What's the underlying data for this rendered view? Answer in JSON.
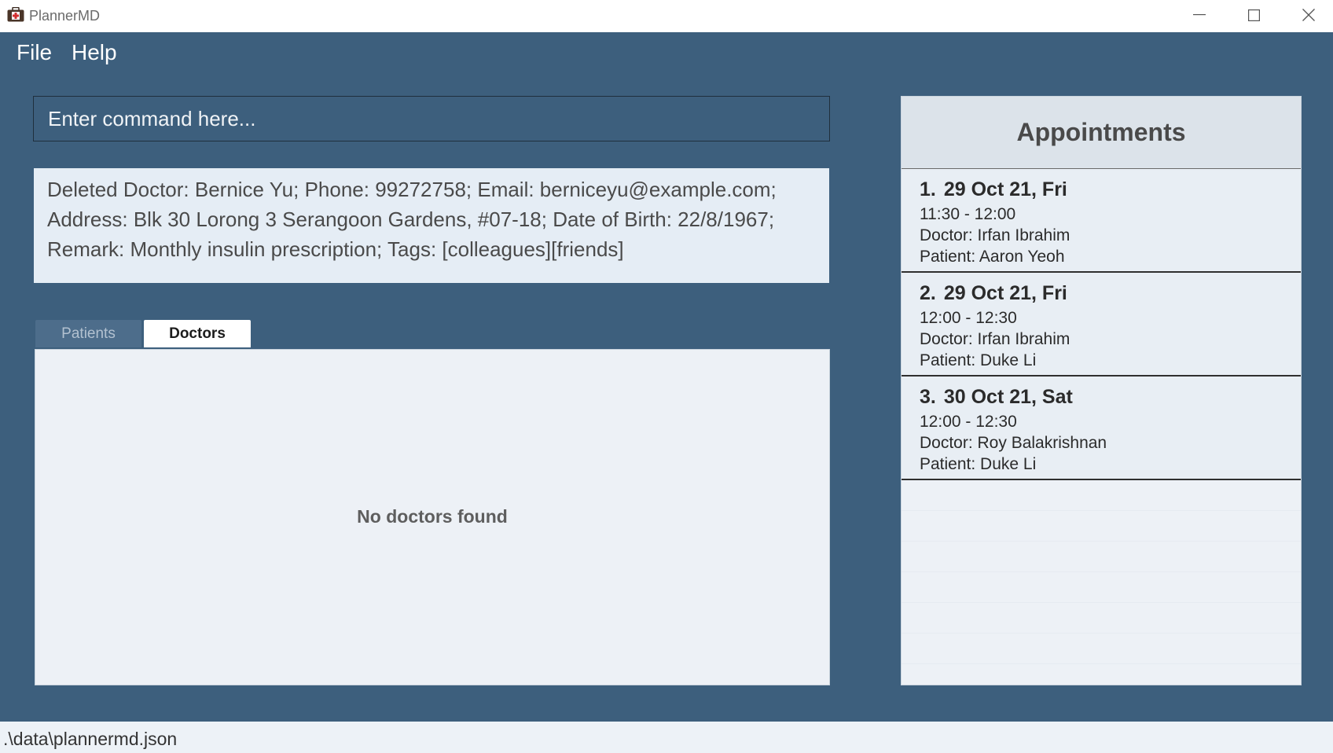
{
  "window": {
    "title": "PlannerMD",
    "icon": "medical-briefcase-icon"
  },
  "menu": {
    "file": "File",
    "help": "Help"
  },
  "command": {
    "placeholder": "Enter command here...",
    "value": ""
  },
  "result": {
    "lines": [
      "Deleted Doctor: Bernice Yu; Phone: 99272758; Email: berniceyu@example.com;",
      "Address: Blk 30 Lorong 3 Serangoon Gardens, #07-18; Date of Birth: 22/8/1967;",
      "Remark: Monthly insulin prescription; Tags: [colleagues][friends]"
    ]
  },
  "tabs": [
    {
      "label": "Patients",
      "selected": false
    },
    {
      "label": "Doctors",
      "selected": true
    }
  ],
  "list": {
    "empty_message": "No doctors found"
  },
  "appointments": {
    "header": "Appointments",
    "items": [
      {
        "index": "1.",
        "date": "29 Oct 21, Fri",
        "time": "11:30 - 12:00",
        "doctor": "Doctor: Irfan Ibrahim",
        "patient": "Patient: Aaron Yeoh"
      },
      {
        "index": "2.",
        "date": "29 Oct 21, Fri",
        "time": "12:00 - 12:30",
        "doctor": "Doctor: Irfan Ibrahim",
        "patient": "Patient: Duke Li"
      },
      {
        "index": "3.",
        "date": "30 Oct 21, Sat",
        "time": "12:00 - 12:30",
        "doctor": "Doctor: Roy Balakrishnan",
        "patient": "Patient: Duke Li"
      }
    ]
  },
  "status": {
    "path": ".\\data\\plannermd.json"
  },
  "colors": {
    "background": "#3d5f7d",
    "panel": "#edf1f6",
    "result_bg": "#e5edf5"
  }
}
